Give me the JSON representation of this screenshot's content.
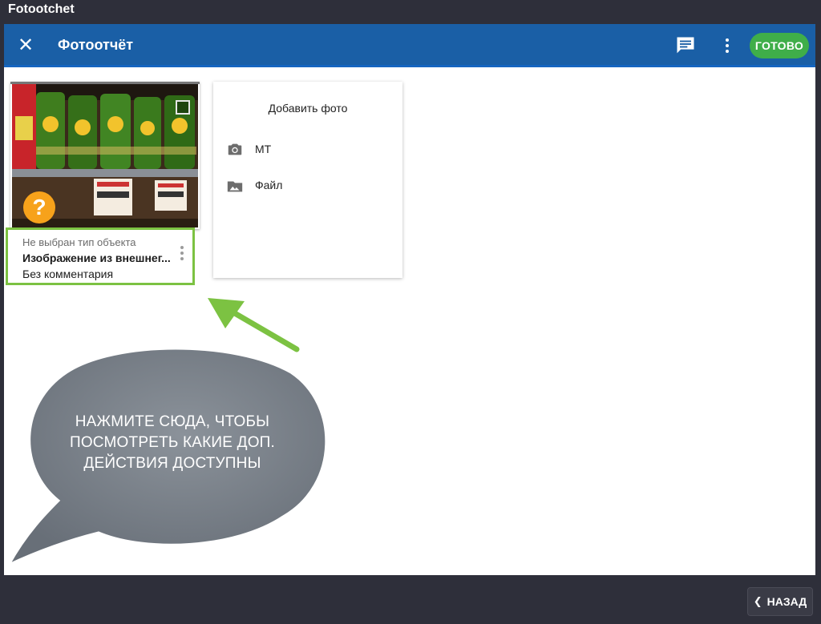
{
  "window": {
    "title": "Fotootchet"
  },
  "appbar": {
    "title": "Фотоотчёт",
    "close_icon": "close-icon",
    "comment_icon": "comment-icon",
    "more_icon": "more-vert-icon",
    "done_label": "ГОТОВО",
    "background_color": "#1a5fa6",
    "done_color": "#3fae49"
  },
  "photo_card": {
    "badge": "?",
    "badge_color": "#f7a21b",
    "object_type": "Не выбран тип объекта",
    "image_name": "Изображение из внешнег...",
    "comment": "Без комментария",
    "more_icon": "more-vert-icon",
    "highlight_color": "#7cc242"
  },
  "add_photo": {
    "title": "Добавить фото",
    "options": [
      {
        "label": "МТ",
        "icon": "camera-icon"
      },
      {
        "label": "Файл",
        "icon": "image-icon"
      }
    ]
  },
  "callout": {
    "text": "НАЖМИТЕ СЮДА, ЧТОБЫ ПОСМОТРЕТЬ КАКИЕ ДОП. ДЕЙСТВИЯ ДОСТУПНЫ",
    "bubble_color": "#747b84",
    "arrow_color": "#7cc242"
  },
  "footer": {
    "back_label": "НАЗАД",
    "back_icon": "chevron-left-icon"
  }
}
